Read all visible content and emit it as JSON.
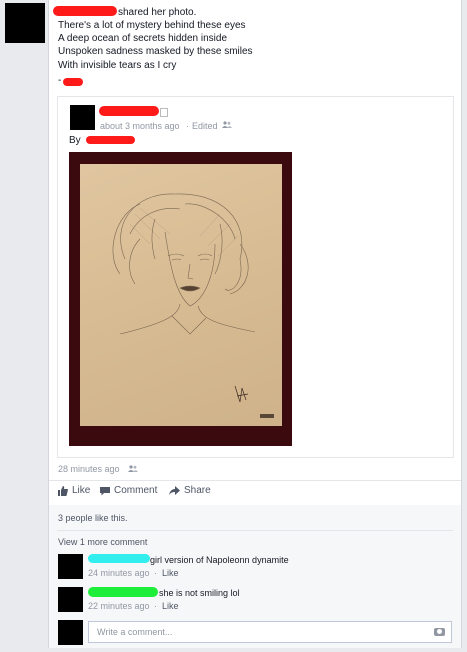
{
  "post": {
    "action_text": "shared her photo.",
    "caption_lines": [
      "There's a lot of mystery behind these eyes",
      "A deep ocean of secrets hidden inside",
      "Unspoken sadness masked by these smiles",
      "With invisible tears as I cry"
    ],
    "signature_dash": "-",
    "timestamp": "28 minutes ago"
  },
  "shared_post": {
    "timestamp": "about 3 months ago",
    "separator": "·",
    "edited": "Edited",
    "by_label": "By",
    "image_alt": "pencil sketch of a woman"
  },
  "actions": {
    "like": "Like",
    "comment": "Comment",
    "share": "Share"
  },
  "likes_summary": "3 people like this.",
  "view_more": "View 1 more comment",
  "comments": [
    {
      "text": "girl version of Napoleonn dynamite",
      "time": "24 minutes ago",
      "like": "Like"
    },
    {
      "text": "she is not smiling lol",
      "time": "22 minutes ago",
      "like": "Like"
    }
  ],
  "composer": {
    "placeholder": "Write a comment..."
  },
  "colors": {
    "redaction": "#ff1a1a",
    "highlight_cyan": "#33eeee",
    "highlight_green": "#1eee3a"
  }
}
